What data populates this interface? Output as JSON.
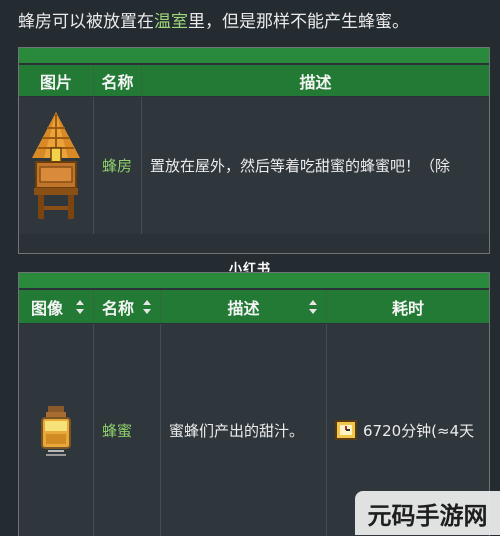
{
  "intro": {
    "before": "蜂房可以被放置在",
    "link": "温室",
    "after": "里，但是那样不能产生蜂蜜。"
  },
  "table1": {
    "headers": [
      "图片",
      "名称",
      "描述"
    ],
    "row": {
      "name": "蜂房",
      "description": "置放在屋外，然后等着吃甜蜜的蜂蜜吧！（除"
    }
  },
  "watermark": "小红书",
  "table2": {
    "headers": [
      "图像",
      "名称",
      "描述",
      "耗时"
    ],
    "row": {
      "name": "蜂蜜",
      "description": "蜜蜂们产出的甜汁。",
      "time": "6720分钟(≈4天"
    }
  },
  "logo_text": "元码手游网",
  "colors": {
    "header_green": "#227a34",
    "link_green": "#8fd06a",
    "background": "#242b31"
  }
}
